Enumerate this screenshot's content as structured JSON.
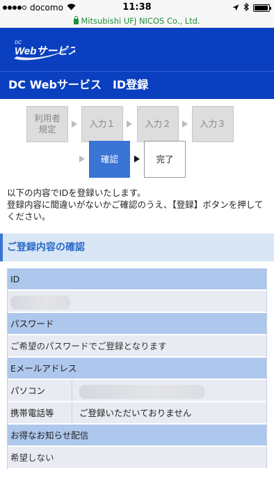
{
  "status": {
    "carrier": "docomo",
    "time": "11:38",
    "battery_level": 0.95
  },
  "url": {
    "host": "Mitsubishi UFJ NICOS Co., Ltd."
  },
  "header": {
    "logo_text": "Webサービス",
    "page_title": "DC Webサービス　ID登録"
  },
  "steps": [
    {
      "label": "利用者\n規定",
      "state": "done"
    },
    {
      "label": "入力１",
      "state": "done"
    },
    {
      "label": "入力２",
      "state": "done"
    },
    {
      "label": "入力３",
      "state": "done"
    },
    {
      "label": "確認",
      "state": "current"
    },
    {
      "label": "完了",
      "state": "next"
    }
  ],
  "intro": {
    "line1": "以下の内容でIDを登録いたします。",
    "line2": "登録内容に間違いがないかご確認のうえ、【登録】ボタンを押してください。"
  },
  "section_title": "ご登録内容の確認",
  "fields": {
    "id_label": "ID",
    "password_label": "パスワード",
    "password_value": "ご希望のパスワードでご登録となります",
    "email_label": "Eメールアドレス",
    "pc_label": "パソコン",
    "mobile_label": "携帯電話等",
    "mobile_value": "ご登録いただいておりません",
    "news_label": "お得なお知らせ配信",
    "news_value": "希望しない"
  },
  "colors": {
    "header_blue": "#0a3fbf",
    "step_current": "#3a74d4",
    "section_bg": "#d8e6f5",
    "row_head": "#aec7ec"
  }
}
